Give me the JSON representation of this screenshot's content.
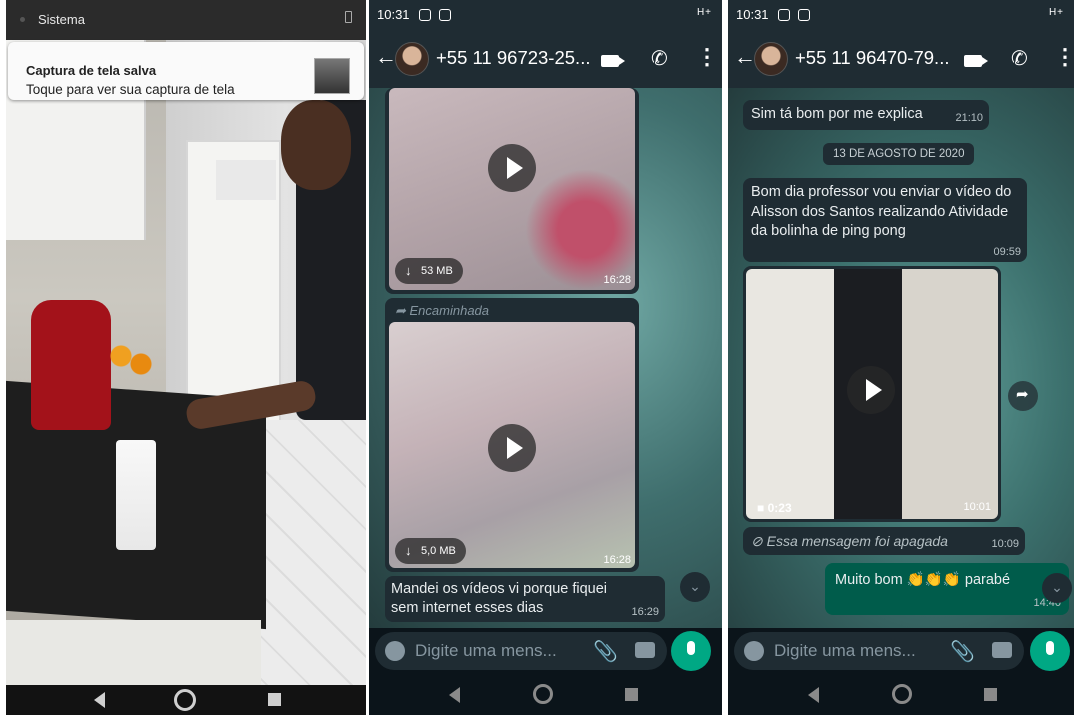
{
  "panel1": {
    "status_label": "Sistema",
    "notification": {
      "title": "Captura de tela salva",
      "body": "Toque para ver sua captura de tela"
    }
  },
  "panel2": {
    "status_time": "10:31",
    "status_right": "H+",
    "contact": "+55 11 96723-25...",
    "messages": [
      {
        "type": "video",
        "size": "53 MB",
        "time": "16:28"
      },
      {
        "type": "video",
        "forwarded": "Encaminhada",
        "size": "5,0 MB",
        "time": "16:28"
      },
      {
        "type": "text",
        "text": "Mandei os vídeos vi porque fiquei sem internet esses dias",
        "time": "16:29"
      }
    ],
    "input_placeholder": "Digite uma mens..."
  },
  "panel3": {
    "status_time": "10:31",
    "status_right": "H+",
    "contact": "+55 11 96470-79...",
    "messages": [
      {
        "type": "text",
        "text": "Sim tá bom por me explica",
        "time": "21:10"
      },
      {
        "type": "date",
        "text": "13 DE AGOSTO DE 2020"
      },
      {
        "type": "text",
        "text": "Bom dia professor vou enviar o vídeo do Alisson dos Santos realizando Atividade da bolinha de ping pong",
        "time": "09:59"
      },
      {
        "type": "video",
        "duration": "0:23",
        "time": "10:01"
      },
      {
        "type": "deleted",
        "text": "Essa mensagem foi apagada",
        "time": "10:09"
      },
      {
        "type": "outgoing",
        "text": "Muito bom 👏👏👏 parabé",
        "time": "14:40"
      }
    ],
    "input_placeholder": "Digite uma mens..."
  },
  "colors": {
    "header": "#1f2c33",
    "accent": "#00a884",
    "outgoing_bubble": "#005c4b",
    "incoming_bubble": "#1f2c33"
  }
}
